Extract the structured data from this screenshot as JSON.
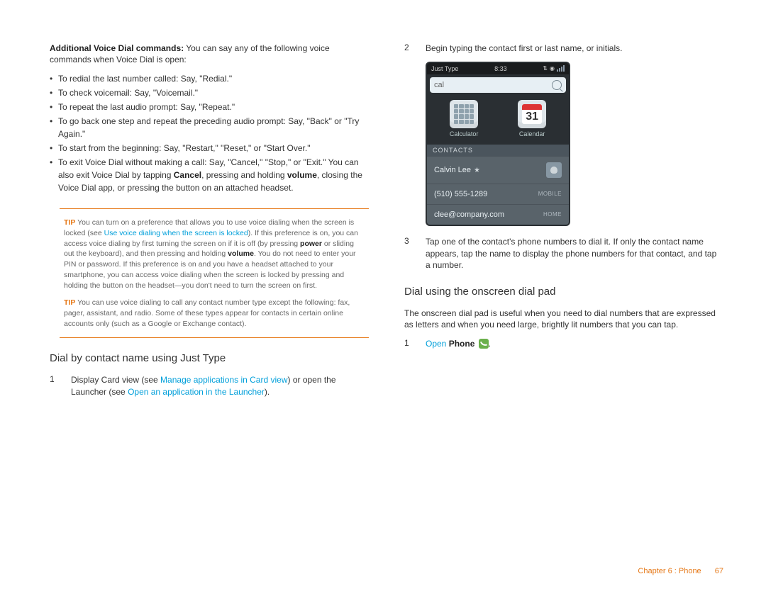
{
  "left": {
    "intro_lead": "Additional Voice Dial commands:",
    "intro_rest": " You can say any of the following voice commands when Voice Dial is open:",
    "bullets": [
      "To redial the last number called: Say, \"Redial.\"",
      "To check voicemail: Say, \"Voicemail.\"",
      "To repeat the last audio prompt: Say, \"Repeat.\"",
      "To go back one step and repeat the preceding audio prompt: Say, \"Back\" or \"Try Again.\"",
      "To start from the beginning: Say, \"Restart,\" \"Reset,\" or \"Start Over.\"",
      "To exit Voice Dial without making a call: Say, \"Cancel,\" \"Stop,\" or \"Exit.\" You can also exit Voice Dial by tapping Cancel, pressing and holding volume, closing the Voice Dial app, or pressing the button on an attached headset."
    ],
    "tip_label": "TIP",
    "tip1_a": "You can turn on a preference that allows you to use voice dialing when the screen is locked (see ",
    "tip1_link": "Use voice dialing when the screen is locked",
    "tip1_b": "). If this preference is on, you can access voice dialing by first turning the screen on if it is off (by pressing ",
    "tip1_bold1": "power",
    "tip1_c": " or sliding out the keyboard), and then pressing and holding ",
    "tip1_bold2": "volume",
    "tip1_d": ". You do not need to enter your PIN or password. If this preference is on and you have a headset attached to your smartphone, you can access voice dialing when the screen is locked by pressing and holding the button on the headset—you don't need to turn the screen on first.",
    "tip2": "You can use voice dialing to call any contact number type except the following: fax, pager, assistant, and radio. Some of these types appear for contacts in certain online accounts only (such as a Google or Exchange contact).",
    "section_title": "Dial by contact name using Just Type",
    "step1_num": "1",
    "step1_a": "Display Card view (see ",
    "step1_link1": "Manage applications in Card view",
    "step1_b": ") or open the Launcher (see ",
    "step1_link2": "Open an application in the Launcher",
    "step1_c": ")."
  },
  "right": {
    "step2_num": "2",
    "step2": "Begin typing the contact first or last name, or initials.",
    "step3_num": "3",
    "step3": "Tap one of the contact's phone numbers to dial it. If only the contact name appears, tap the name to display the phone numbers for that contact, and tap a number.",
    "section_title": "Dial using the onscreen dial pad",
    "section_intro": "The onscreen dial pad is useful when you need to dial numbers that are expressed as letters and when you need large, brightly lit numbers that you can tap.",
    "step1_num": "1",
    "step1_link": "Open",
    "step1_bold": "Phone",
    "step1_tail": "."
  },
  "phone": {
    "status_left": "Just Type",
    "status_time": "8:33",
    "search_value": "cal",
    "app1": "Calculator",
    "app2": "Calendar",
    "cal_day": "31",
    "section": "CONTACTS",
    "contact_name": "Calvin Lee",
    "contact_phone": "(510) 555-1289",
    "contact_phone_type": "MOBILE",
    "contact_email": "clee@company.com",
    "contact_email_type": "HOME"
  },
  "footer": {
    "chapter": "Chapter 6 : Phone",
    "page": "67"
  }
}
